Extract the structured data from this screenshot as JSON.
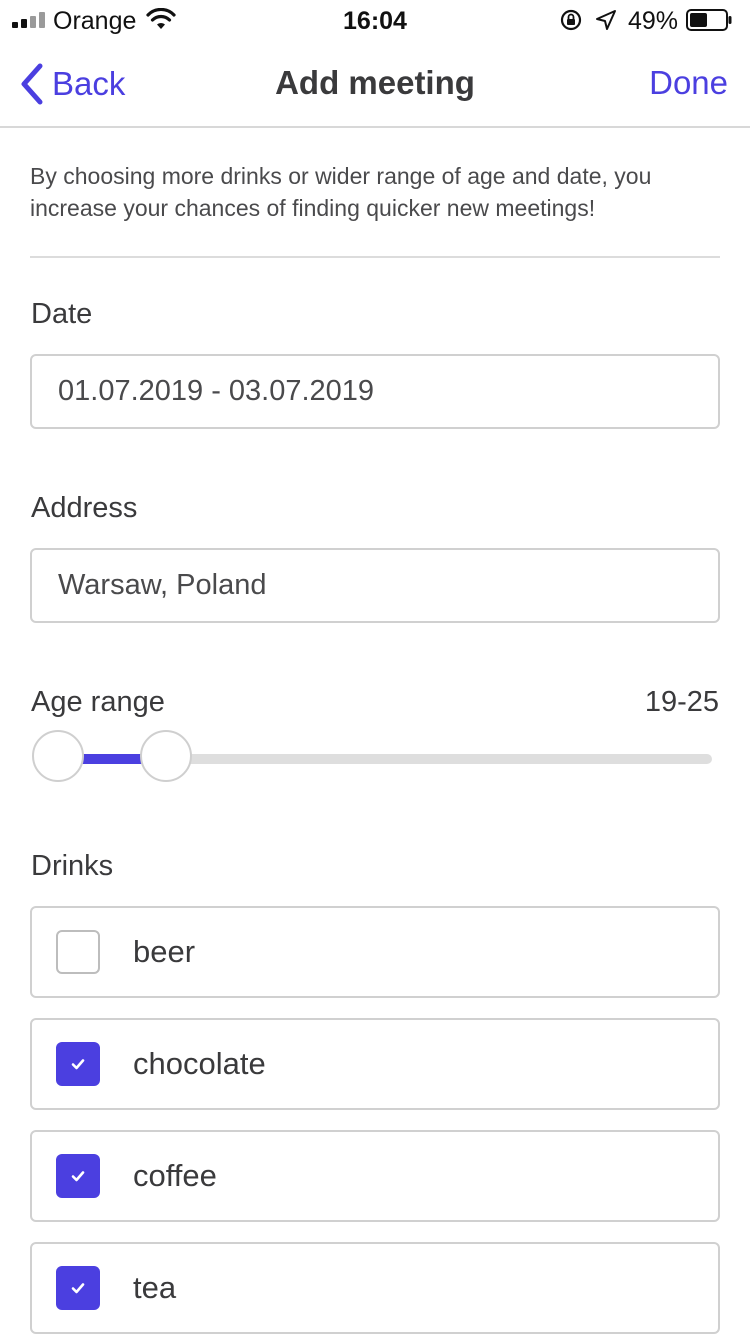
{
  "status": {
    "carrier": "Orange",
    "time": "16:04",
    "battery": "49%",
    "battery_level": 0.49
  },
  "nav": {
    "back_label": "Back",
    "title": "Add meeting",
    "done_label": "Done"
  },
  "info": "By choosing more drinks or wider range of age and date, you increase your chances of finding quicker new meetings!",
  "date": {
    "label": "Date",
    "value": "01.07.2019 - 03.07.2019"
  },
  "address": {
    "label": "Address",
    "value": "Warsaw, Poland"
  },
  "age": {
    "label": "Age range",
    "value": "19-25",
    "min": 19,
    "max": 25
  },
  "drinks": {
    "label": "Drinks",
    "items": [
      {
        "label": "beer",
        "checked": false
      },
      {
        "label": "chocolate",
        "checked": true
      },
      {
        "label": "coffee",
        "checked": true
      },
      {
        "label": "tea",
        "checked": true
      }
    ]
  },
  "colors": {
    "accent": "#4b3fe0",
    "border": "#d0d0d0"
  }
}
